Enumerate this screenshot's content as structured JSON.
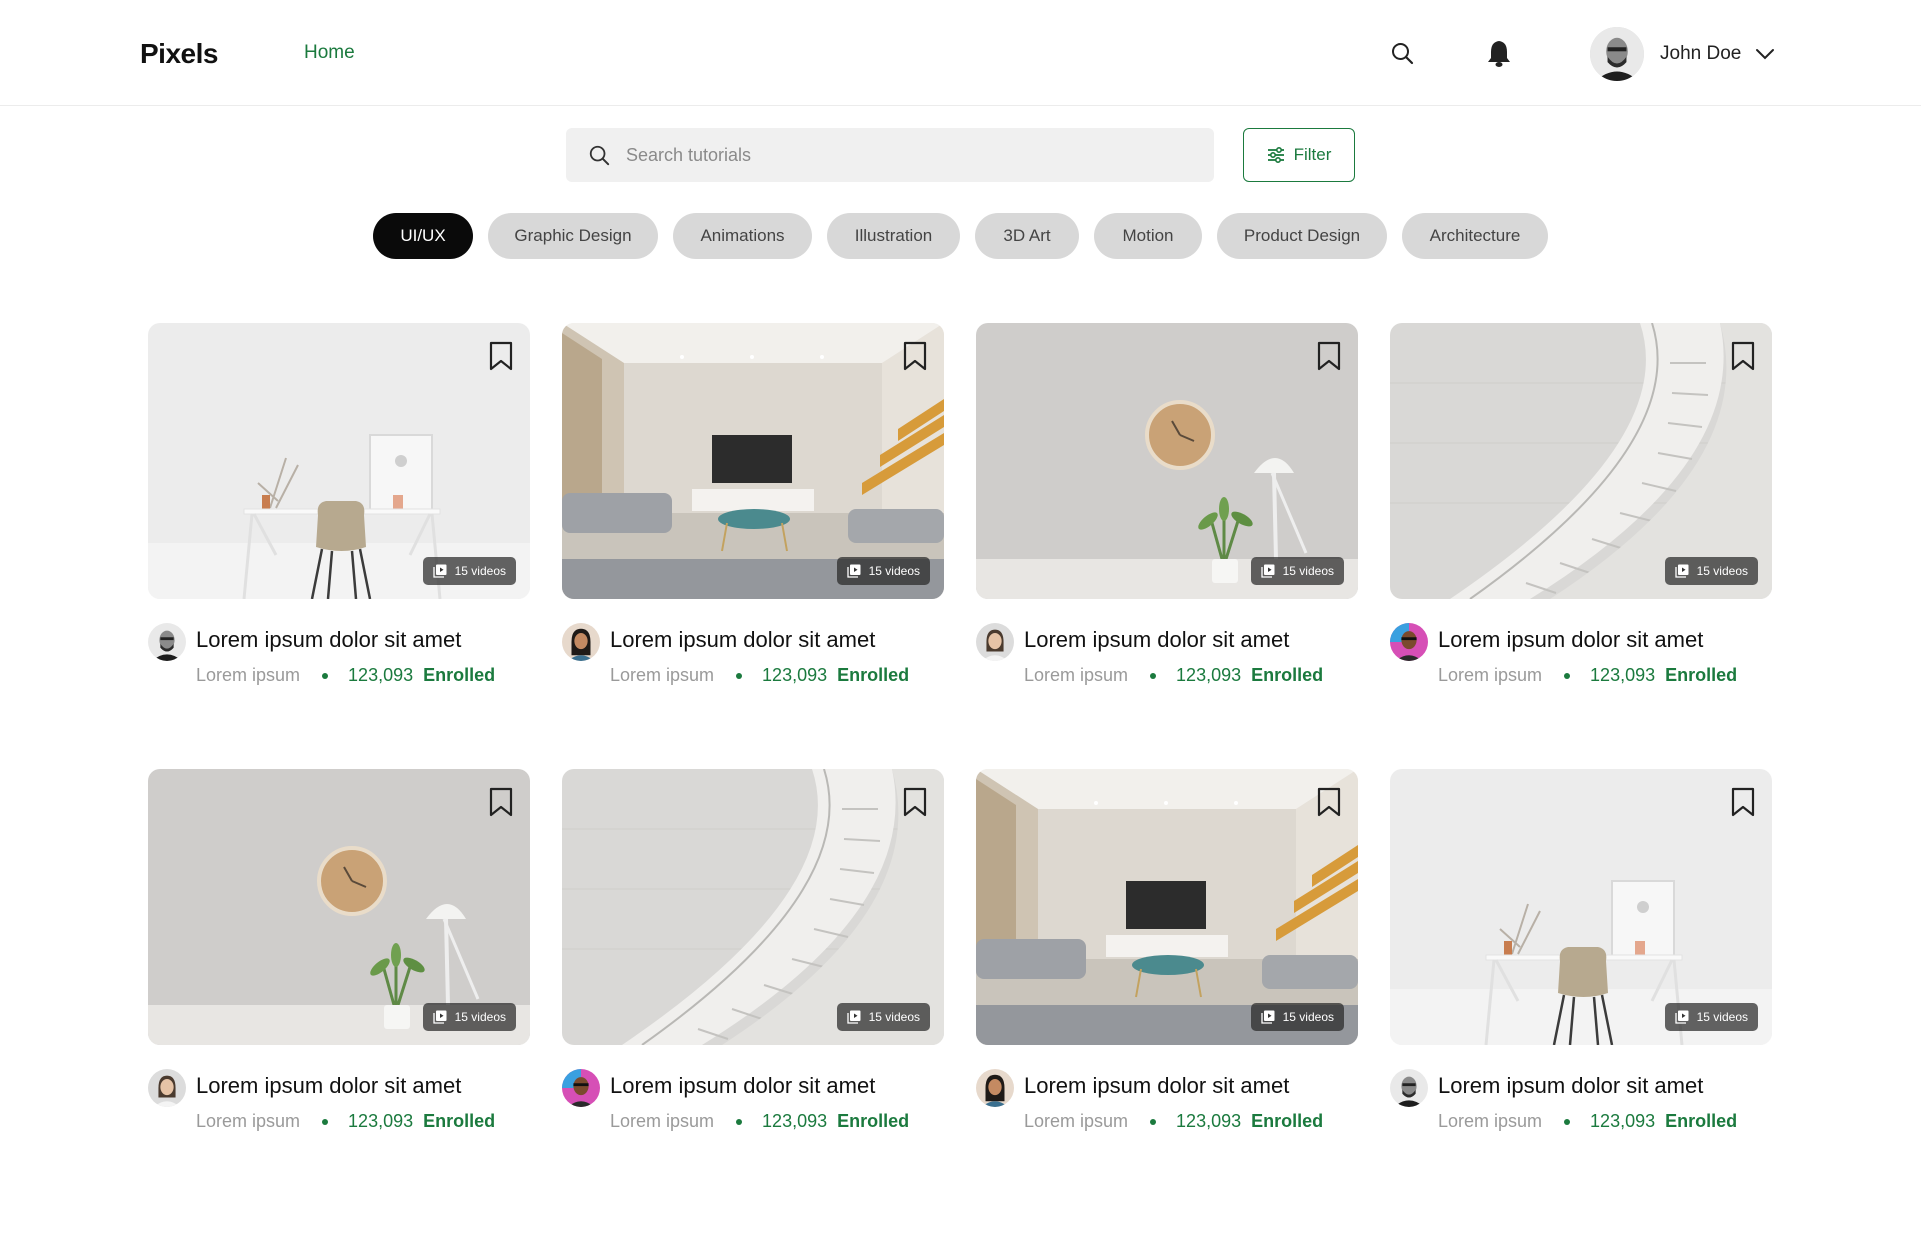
{
  "header": {
    "logo": "Pixels",
    "nav_home": "Home",
    "user_name": "John Doe",
    "icons": [
      "search-icon",
      "bell-icon",
      "chevron-down-icon"
    ]
  },
  "search": {
    "placeholder": "Search tutorials"
  },
  "filter": {
    "label": "Filter"
  },
  "categories": [
    {
      "label": "UI/UX",
      "active": true
    },
    {
      "label": "Graphic Design",
      "active": false
    },
    {
      "label": "Animations",
      "active": false
    },
    {
      "label": "Illustration",
      "active": false
    },
    {
      "label": "3D Art",
      "active": false
    },
    {
      "label": "Motion",
      "active": false
    },
    {
      "label": "Product Design",
      "active": false
    },
    {
      "label": "Architecture",
      "active": false
    }
  ],
  "courses": [
    {
      "title": "Lorem ipsum dolor sit amet",
      "author": "Lorem ipsum",
      "count": "123,093",
      "enrolled_label": "Enrolled",
      "videos": "15 videos",
      "scene": "desk",
      "avatar": "man-beard"
    },
    {
      "title": "Lorem ipsum dolor sit amet",
      "author": "Lorem ipsum",
      "count": "123,093",
      "enrolled_label": "Enrolled",
      "videos": "15 videos",
      "scene": "living-room",
      "avatar": "woman-dark-hair"
    },
    {
      "title": "Lorem ipsum dolor sit amet",
      "author": "Lorem ipsum",
      "count": "123,093",
      "enrolled_label": "Enrolled",
      "videos": "15 videos",
      "scene": "clock-lamp",
      "avatar": "woman-light"
    },
    {
      "title": "Lorem ipsum dolor sit amet",
      "author": "Lorem ipsum",
      "count": "123,093",
      "enrolled_label": "Enrolled",
      "videos": "15 videos",
      "scene": "staircase",
      "avatar": "man-colorful"
    },
    {
      "title": "Lorem ipsum dolor sit amet",
      "author": "Lorem ipsum",
      "count": "123,093",
      "enrolled_label": "Enrolled",
      "videos": "15 videos",
      "scene": "clock-lamp",
      "avatar": "woman-light"
    },
    {
      "title": "Lorem ipsum dolor sit amet",
      "author": "Lorem ipsum",
      "count": "123,093",
      "enrolled_label": "Enrolled",
      "videos": "15 videos",
      "scene": "staircase",
      "avatar": "man-colorful"
    },
    {
      "title": "Lorem ipsum dolor sit amet",
      "author": "Lorem ipsum",
      "count": "123,093",
      "enrolled_label": "Enrolled",
      "videos": "15 videos",
      "scene": "living-room",
      "avatar": "woman-dark-hair"
    },
    {
      "title": "Lorem ipsum dolor sit amet",
      "author": "Lorem ipsum",
      "count": "123,093",
      "enrolled_label": "Enrolled",
      "videos": "15 videos",
      "scene": "desk",
      "avatar": "man-beard"
    }
  ],
  "colors": {
    "accent": "#1b7a3e",
    "chip_bg": "#d8d8d8",
    "chip_active_bg": "#0a0a0a",
    "search_bg": "#f0f0f0"
  }
}
